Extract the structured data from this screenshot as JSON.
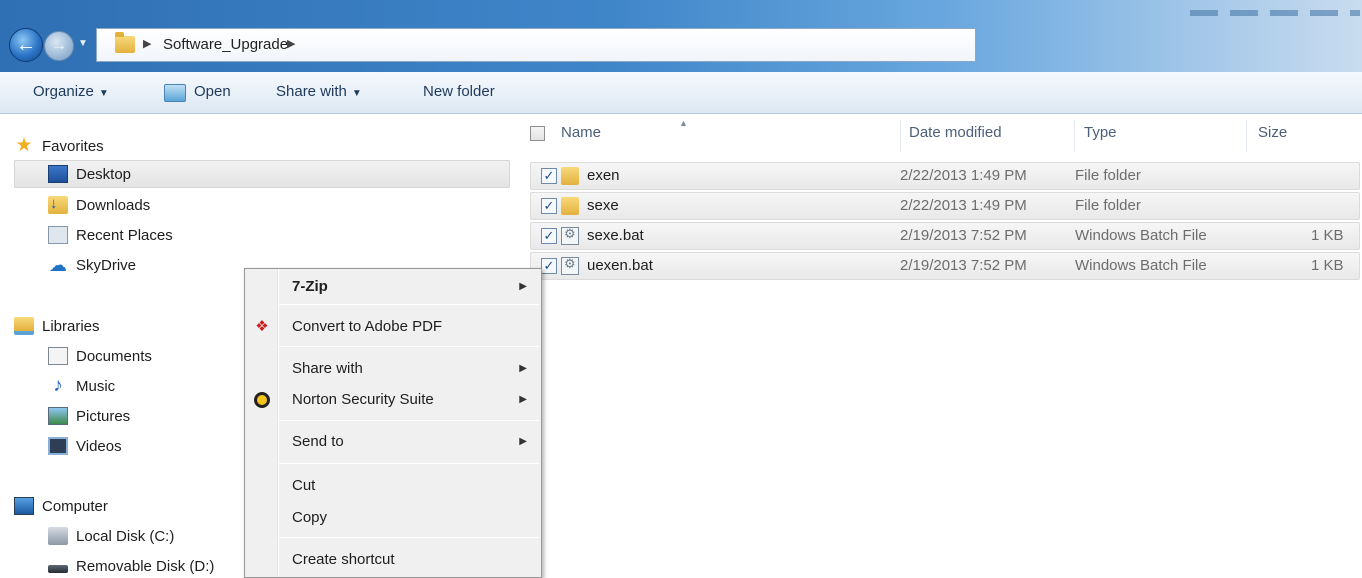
{
  "address_bar": {
    "crumbs": [
      "Software_Upgrade"
    ]
  },
  "toolbar": {
    "organize": "Organize",
    "open": "Open",
    "share_with": "Share with",
    "new_folder": "New folder"
  },
  "navigation": {
    "favorites": {
      "label": "Favorites",
      "items": [
        "Desktop",
        "Downloads",
        "Recent Places",
        "SkyDrive"
      ],
      "selected": "Desktop"
    },
    "libraries": {
      "label": "Libraries",
      "items": [
        "Documents",
        "Music",
        "Pictures",
        "Videos"
      ]
    },
    "computer": {
      "label": "Computer",
      "items": [
        "Local Disk (C:)",
        "Removable Disk (D:)"
      ]
    }
  },
  "file_list": {
    "columns": [
      "Name",
      "Date modified",
      "Type",
      "Size"
    ],
    "sort_column": "Name",
    "rows": [
      {
        "name": "exen",
        "date": "2/22/2013 1:49 PM",
        "type": "File folder",
        "size": "",
        "icon": "folder-icon",
        "checked": true
      },
      {
        "name": "sexe",
        "date": "2/22/2013 1:49 PM",
        "type": "File folder",
        "size": "",
        "icon": "folder-icon",
        "checked": true
      },
      {
        "name": "sexe.bat",
        "date": "2/19/2013 7:52 PM",
        "type": "Windows Batch File",
        "size": "1 KB",
        "icon": "batch-file-icon",
        "checked": true
      },
      {
        "name": "uexen.bat",
        "date": "2/19/2013 7:52 PM",
        "type": "Windows Batch File",
        "size": "1 KB",
        "icon": "batch-file-icon",
        "checked": true
      }
    ]
  },
  "context_menu": {
    "items": [
      {
        "label": "7-Zip",
        "submenu": true,
        "bold": true
      },
      {
        "label": "Convert to Adobe PDF",
        "icon": "adobe-pdf-icon"
      },
      {
        "label": "Share with",
        "submenu": true
      },
      {
        "label": "Norton Security Suite",
        "submenu": true,
        "icon": "norton-icon"
      },
      {
        "label": "Send to",
        "submenu": true
      },
      {
        "label": "Cut"
      },
      {
        "label": "Copy"
      },
      {
        "label": "Create shortcut"
      }
    ]
  }
}
